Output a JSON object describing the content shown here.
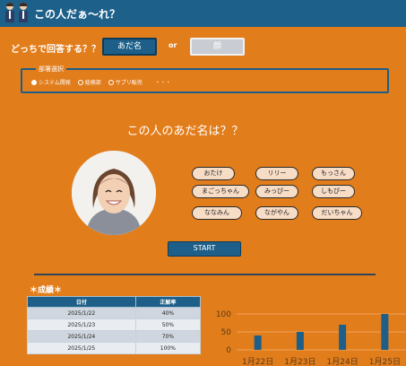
{
  "app": {
    "title": "この人だぁ～れ？"
  },
  "mode": {
    "label": "どっちで回答する？？",
    "nickname_button": "あだ名",
    "or_label": "or",
    "face_button": "顔"
  },
  "department": {
    "title": "部署選択",
    "options": [
      {
        "label": "システム開発",
        "selected": true
      },
      {
        "label": "総務部",
        "selected": false
      },
      {
        "label": "サプリ販売",
        "selected": false
      }
    ],
    "more": "・・・"
  },
  "question": "この人のあだ名は？？",
  "choices": [
    "おたけ",
    "リリー",
    "もっさん",
    "まごっちゃん",
    "みっぴー",
    "しもぴー",
    "ななみん",
    "ながやん",
    "だいちゃん"
  ],
  "start_button": "START",
  "results": {
    "title": "＊成績＊",
    "columns": [
      "日付",
      "正解率"
    ],
    "rows": [
      [
        "2025/1/22",
        "40%"
      ],
      [
        "2025/1/23",
        "50%"
      ],
      [
        "2025/1/24",
        "70%"
      ],
      [
        "2025/1/25",
        "100%"
      ]
    ]
  },
  "chart_data": {
    "type": "bar",
    "categories": [
      "1月22日",
      "1月23日",
      "1月24日",
      "1月25日"
    ],
    "values": [
      40,
      50,
      70,
      100
    ],
    "yticks": [
      0,
      50,
      100
    ],
    "ylim": [
      0,
      100
    ],
    "grid": true,
    "bar_color": "#1d5f88"
  },
  "colors": {
    "background": "#e27d1b",
    "accent": "#1d5f88"
  }
}
